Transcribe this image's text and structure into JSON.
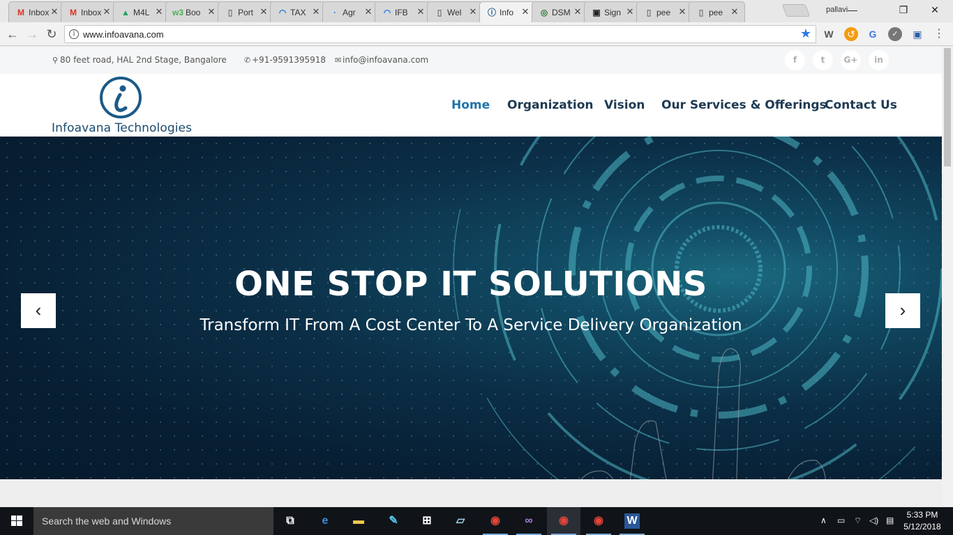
{
  "browser": {
    "tabs": [
      {
        "label": "Inbox",
        "icon": "gmail-icon",
        "glyph": "M",
        "color": "#d93025"
      },
      {
        "label": "Inbox",
        "icon": "gmail-icon",
        "glyph": "M",
        "color": "#d93025"
      },
      {
        "label": "M4L",
        "icon": "google-drive-icon",
        "glyph": "▲",
        "color": "#1fa463"
      },
      {
        "label": "Boo",
        "icon": "w3schools-icon",
        "glyph": "w3",
        "color": "#4caf50"
      },
      {
        "label": "Port",
        "icon": "page-icon",
        "glyph": "▯",
        "color": "#777777"
      },
      {
        "label": "TAX",
        "icon": "loading-icon",
        "glyph": "◠",
        "color": "#1a73e8"
      },
      {
        "label": "Agr",
        "icon": "dot-icon",
        "glyph": "·",
        "color": "#1a73e8"
      },
      {
        "label": "IFB",
        "icon": "loading-icon",
        "glyph": "◠",
        "color": "#1a73e8"
      },
      {
        "label": "Wel",
        "icon": "page-icon",
        "glyph": "▯",
        "color": "#777777"
      },
      {
        "label": "Info",
        "icon": "infoavana-icon",
        "glyph": "ⓘ",
        "color": "#1a5a88",
        "active": true
      },
      {
        "label": "DSM",
        "icon": "dsm-icon",
        "glyph": "◎",
        "color": "#2e7d32"
      },
      {
        "label": "Sign",
        "icon": "sign-icon",
        "glyph": "▣",
        "color": "#222222"
      },
      {
        "label": "pee",
        "icon": "page-icon",
        "glyph": "▯",
        "color": "#777777"
      },
      {
        "label": "pee",
        "icon": "page-icon",
        "glyph": "▯",
        "color": "#777777"
      }
    ],
    "close_glyph": "✕",
    "profile_name": "pallavi",
    "window": {
      "minimize": "—",
      "maximize": "❐",
      "close": "✕"
    },
    "url": "www.infoavana.com",
    "nav": {
      "back": "←",
      "forward": "→",
      "reload": "↻"
    }
  },
  "site": {
    "topbar": {
      "address": "80 feet road, HAL 2nd Stage, Bangalore",
      "phone": "+91-9591395918",
      "email": "info@infoavana.com",
      "social": [
        {
          "name": "facebook-icon",
          "glyph": "f"
        },
        {
          "name": "twitter-icon",
          "glyph": "t"
        },
        {
          "name": "google-plus-icon",
          "glyph": "G+"
        },
        {
          "name": "linkedin-icon",
          "glyph": "in"
        }
      ]
    },
    "logo_text": "Infoavana Technologies",
    "nav": {
      "home": "Home",
      "organization": "Organization",
      "vision": "Vision",
      "services": "Our Services & Offerings",
      "contact": "Contact Us"
    },
    "hero": {
      "title": "ONE STOP IT SOLUTIONS",
      "subtitle": "Transform IT From A Cost Center To A Service Delivery Organization",
      "prev": "‹",
      "next": "›"
    }
  },
  "taskbar": {
    "search_placeholder": "Search the web and Windows",
    "time": "5:33 PM",
    "date": "5/12/2018"
  },
  "colors": {
    "accent": "#2173a8",
    "nav_text": "#1e3a52",
    "hero_dark": "#071e33"
  }
}
